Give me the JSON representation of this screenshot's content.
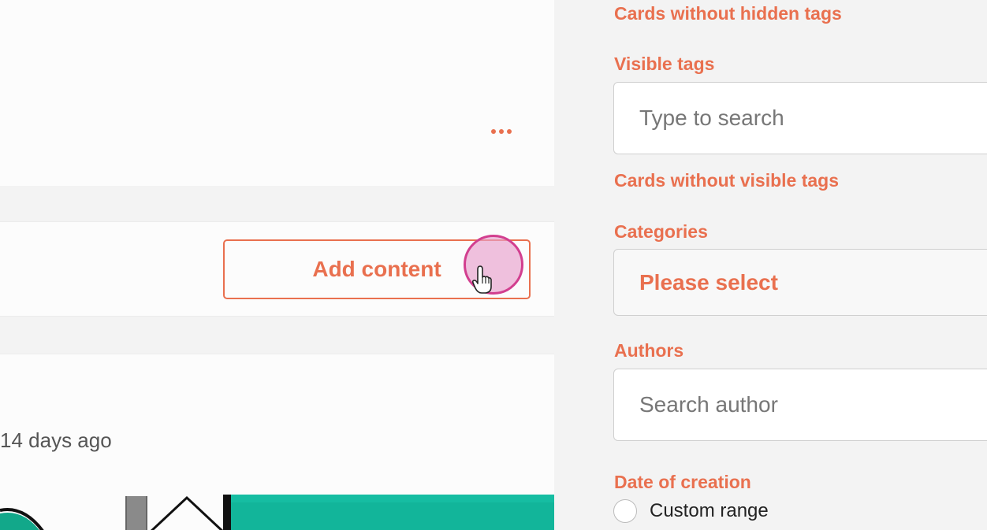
{
  "feed": {
    "add_content_label": "Add content",
    "time_ago": "14 days ago"
  },
  "filters": {
    "hidden_tags_toggle": "Cards without hidden tags",
    "visible_tags_label": "Visible tags",
    "visible_tags_placeholder": "Type to search",
    "visible_tags_toggle": "Cards without visible tags",
    "categories_label": "Categories",
    "categories_value": "Please select",
    "authors_label": "Authors",
    "authors_placeholder": "Search author",
    "date_label": "Date of creation",
    "date_option_custom": "Custom range"
  },
  "colors": {
    "accent": "#e9704f",
    "click_highlight": "#d23f8f",
    "image_teal": "#12b59a"
  },
  "icons": {
    "more": "more-horizontal-icon",
    "cursor": "hand-pointer-icon"
  }
}
